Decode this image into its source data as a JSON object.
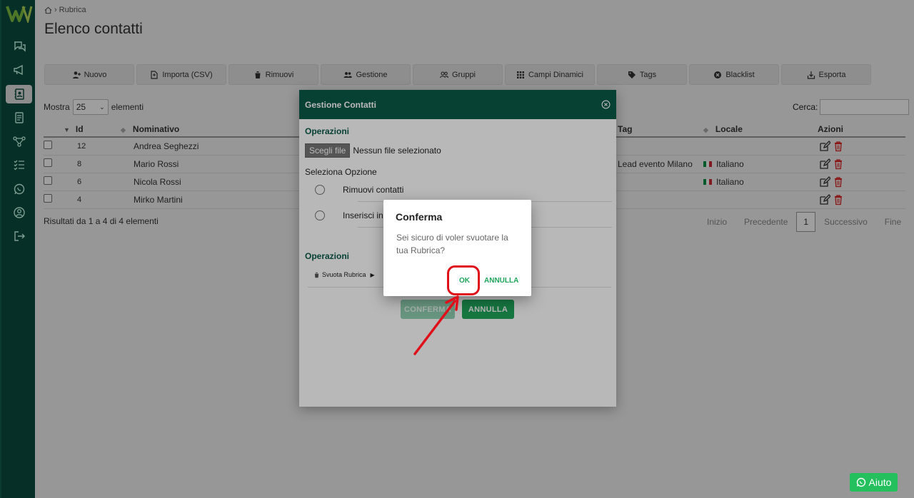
{
  "breadcrumb": {
    "label": "Rubrica"
  },
  "page": {
    "title": "Elenco contatti"
  },
  "toolbar": [
    {
      "label": "Nuovo",
      "icon": "user-plus-icon"
    },
    {
      "label": "Importa (CSV)",
      "icon": "import-icon"
    },
    {
      "label": "Rimuovi",
      "icon": "trash-icon"
    },
    {
      "label": "Gestione",
      "icon": "users-icon"
    },
    {
      "label": "Gruppi",
      "icon": "group-icon"
    },
    {
      "label": "Campi Dinamici",
      "icon": "grid-icon"
    },
    {
      "label": "Tags",
      "icon": "tag-icon"
    },
    {
      "label": "Blacklist",
      "icon": "block-icon"
    },
    {
      "label": "Esporta",
      "icon": "export-icon"
    }
  ],
  "list": {
    "show_prefix": "Mostra",
    "show_value": "25",
    "show_suffix": "elementi",
    "search_label": "Cerca:",
    "columns": [
      "Id",
      "Nominativo",
      "Tag",
      "Locale",
      "Azioni"
    ],
    "rows": [
      {
        "id": "12",
        "name": "Andrea Seghezzi",
        "tag": "",
        "locale": ""
      },
      {
        "id": "8",
        "name": "Mario Rossi",
        "tag": "Lead evento Milano",
        "locale": "Italiano"
      },
      {
        "id": "6",
        "name": "Nicola Rossi",
        "tag": "",
        "locale": "Italiano"
      },
      {
        "id": "4",
        "name": "Mirko Martini",
        "tag": "",
        "locale": ""
      }
    ],
    "results": "Risultati da 1 a 4 di 4 elementi",
    "pager": {
      "first": "Inizio",
      "prev": "Precedente",
      "current": "1",
      "next": "Successivo",
      "last": "Fine"
    }
  },
  "modal": {
    "title": "Gestione Contatti",
    "section1": "Operazioni",
    "file_button": "Scegli file",
    "file_status": "Nessun file selezionato",
    "select_label": "Seleziona Opzione",
    "option1": "Rimuovi contatti",
    "option2": "Inserisci in",
    "section2": "Operazioni",
    "svuota": "Svuota Rubrica",
    "confirm_btn": "CONFERMA",
    "cancel_btn": "ANNULLA"
  },
  "dialog": {
    "title": "Conferma",
    "message": "Sei sicuro di voler svuotare la tua Rubrica?",
    "ok": "OK",
    "cancel": "ANNULLA"
  },
  "help": {
    "label": "Aiuto"
  },
  "colors": {
    "sidebar": "#0a4e3f",
    "modal_header": "#0a5a47",
    "accent": "#1fa55a",
    "annotation": "#e0101a"
  }
}
